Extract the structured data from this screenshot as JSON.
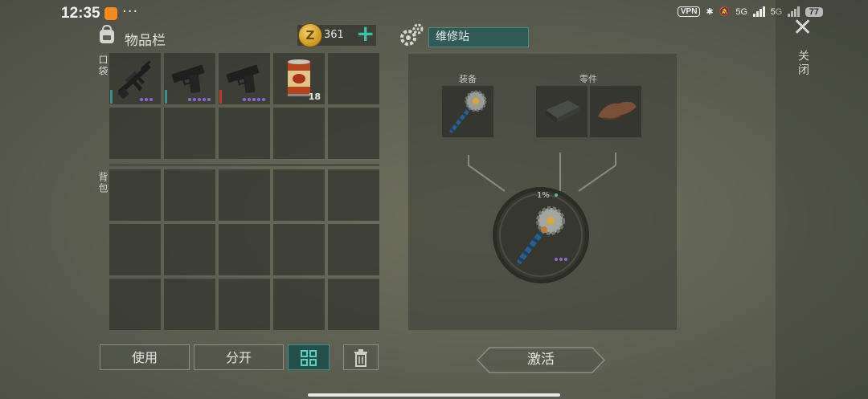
{
  "status_bar": {
    "time": "12:35",
    "more": "···",
    "vpn": "VPN",
    "net1": "5G",
    "net2": "5G",
    "battery": "77"
  },
  "close": {
    "label": "关闭"
  },
  "inventory": {
    "title": "物品栏",
    "coins": "361",
    "coin_symbol": "Z",
    "pocket_label": "口袋",
    "backpack_label": "背包",
    "pocket_slots": [
      {
        "item": "assault-rifle",
        "rarity_color": "#3a8f86",
        "rarity_dots": 3
      },
      {
        "item": "pistol",
        "rarity_color": "#3a8f86",
        "rarity_dots": 5
      },
      {
        "item": "pistol",
        "rarity_color": "#c0392b",
        "rarity_dots": 5
      },
      {
        "item": "canned-food",
        "qty": "18"
      },
      {}
    ]
  },
  "buttons": {
    "use": "使用",
    "split": "分开"
  },
  "repair_station": {
    "title": "维修站",
    "equipment_label": "装备",
    "parts_label": "零件",
    "progress": "1%",
    "activate": "激活"
  },
  "colors": {
    "accent_teal": "#3cc0a8",
    "rarity_purple": "#8a6ad8"
  }
}
